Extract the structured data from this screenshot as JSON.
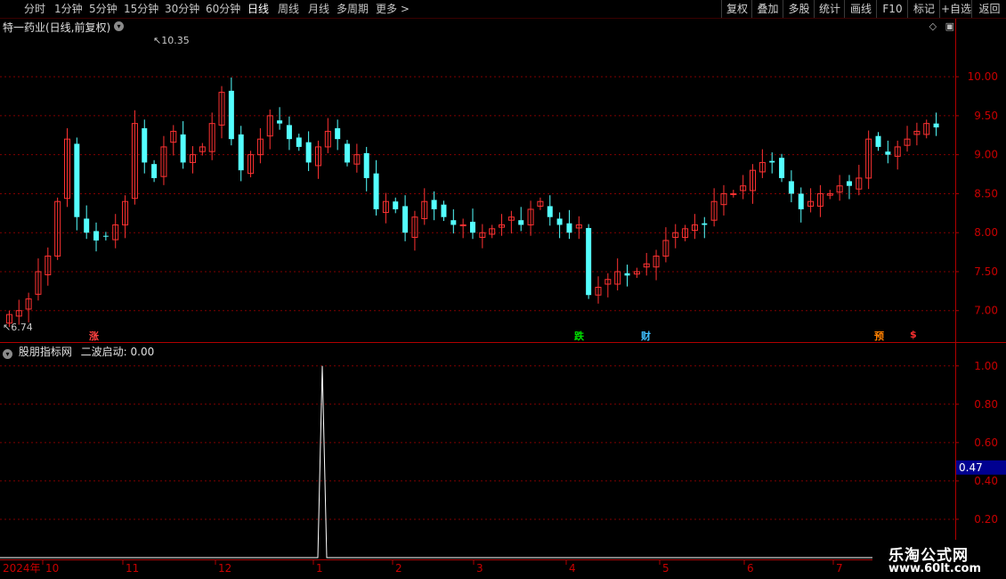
{
  "toolbar": {
    "periods": [
      "分时",
      "1分钟",
      "5分钟",
      "15分钟",
      "30分钟",
      "60分钟",
      "日线",
      "周线",
      "月线",
      "多周期",
      "更多"
    ],
    "active_period": "日线",
    "right_buttons": [
      "复权",
      "叠加",
      "多股",
      "统计",
      "画线",
      "F10",
      "标记",
      "+自选",
      "返回"
    ]
  },
  "main_panel": {
    "title": "特一药业(日线,前复权)",
    "high_label": "10.35",
    "low_label": "6.74",
    "flags": [
      {
        "text": "涨",
        "color": "#ff4040"
      },
      {
        "text": "跌",
        "color": "#00e000"
      },
      {
        "text": "财",
        "color": "#40c0ff"
      },
      {
        "text": "预",
        "color": "#ff8000"
      },
      {
        "text": "$",
        "color": "#ff3030"
      }
    ]
  },
  "indicator_panel": {
    "title": "股朋指标网",
    "line_label": "二波启动: 0.00",
    "current_value": "0.47"
  },
  "x_axis": {
    "year_label": "2024年",
    "months": [
      "10",
      "11",
      "12",
      "1",
      "2",
      "3",
      "4",
      "5",
      "6",
      "7"
    ]
  },
  "watermark": {
    "title": "乐淘公式网",
    "url": "www.60lt.com"
  },
  "colors": {
    "up": "#ff3232",
    "down": "#54ffff",
    "grid": "#800000",
    "axis_text": "#c80000",
    "indicator_line": "#ffffff"
  },
  "chart_data": [
    {
      "type": "candlestick",
      "title": "特一药业(日线,前复权)",
      "y_ticks": [
        7.0,
        7.5,
        8.0,
        8.5,
        9.0,
        9.5,
        10.0
      ],
      "ylim": [
        6.62,
        10.55
      ],
      "period": "2024-09 to 2025-07",
      "max": 10.35,
      "min": 6.74,
      "close_series_approx": [
        6.95,
        7.0,
        7.15,
        7.5,
        7.7,
        8.4,
        9.2,
        8.2,
        8.0,
        7.9,
        7.95,
        8.1,
        8.4,
        9.4,
        8.9,
        8.7,
        9.1,
        9.3,
        8.9,
        9.0,
        9.1,
        9.4,
        9.8,
        9.2,
        8.8,
        9.0,
        9.2,
        9.5,
        9.4,
        9.2,
        9.1,
        8.9,
        9.1,
        9.3,
        9.2,
        8.9,
        9.0,
        8.7,
        8.3,
        8.4,
        8.3,
        8.0,
        8.2,
        8.4,
        8.3,
        8.2,
        8.1,
        8.1,
        8.0,
        8.0,
        8.05,
        8.1,
        8.2,
        8.1,
        8.3,
        8.4,
        8.2,
        8.1,
        8.0,
        8.1,
        7.2,
        7.3,
        7.4,
        7.5,
        7.45,
        7.5,
        7.6,
        7.7,
        7.9,
        8.0,
        8.05,
        8.1,
        8.1,
        8.4,
        8.5,
        8.5,
        8.6,
        8.8,
        8.9,
        8.9,
        8.7,
        8.5,
        8.3,
        8.4,
        8.5,
        8.5,
        8.6,
        8.6,
        8.7,
        9.2,
        9.1,
        9.0,
        9.1,
        9.2,
        9.3,
        9.4,
        9.35
      ]
    },
    {
      "type": "line",
      "name": "二波启动",
      "y_ticks": [
        0.2,
        0.4,
        0.6,
        0.8,
        1.0
      ],
      "ylim": [
        0.0,
        1.05
      ],
      "values_summary": "0 everywhere except a single spike to 1.00 near the start of January 2025"
    }
  ]
}
